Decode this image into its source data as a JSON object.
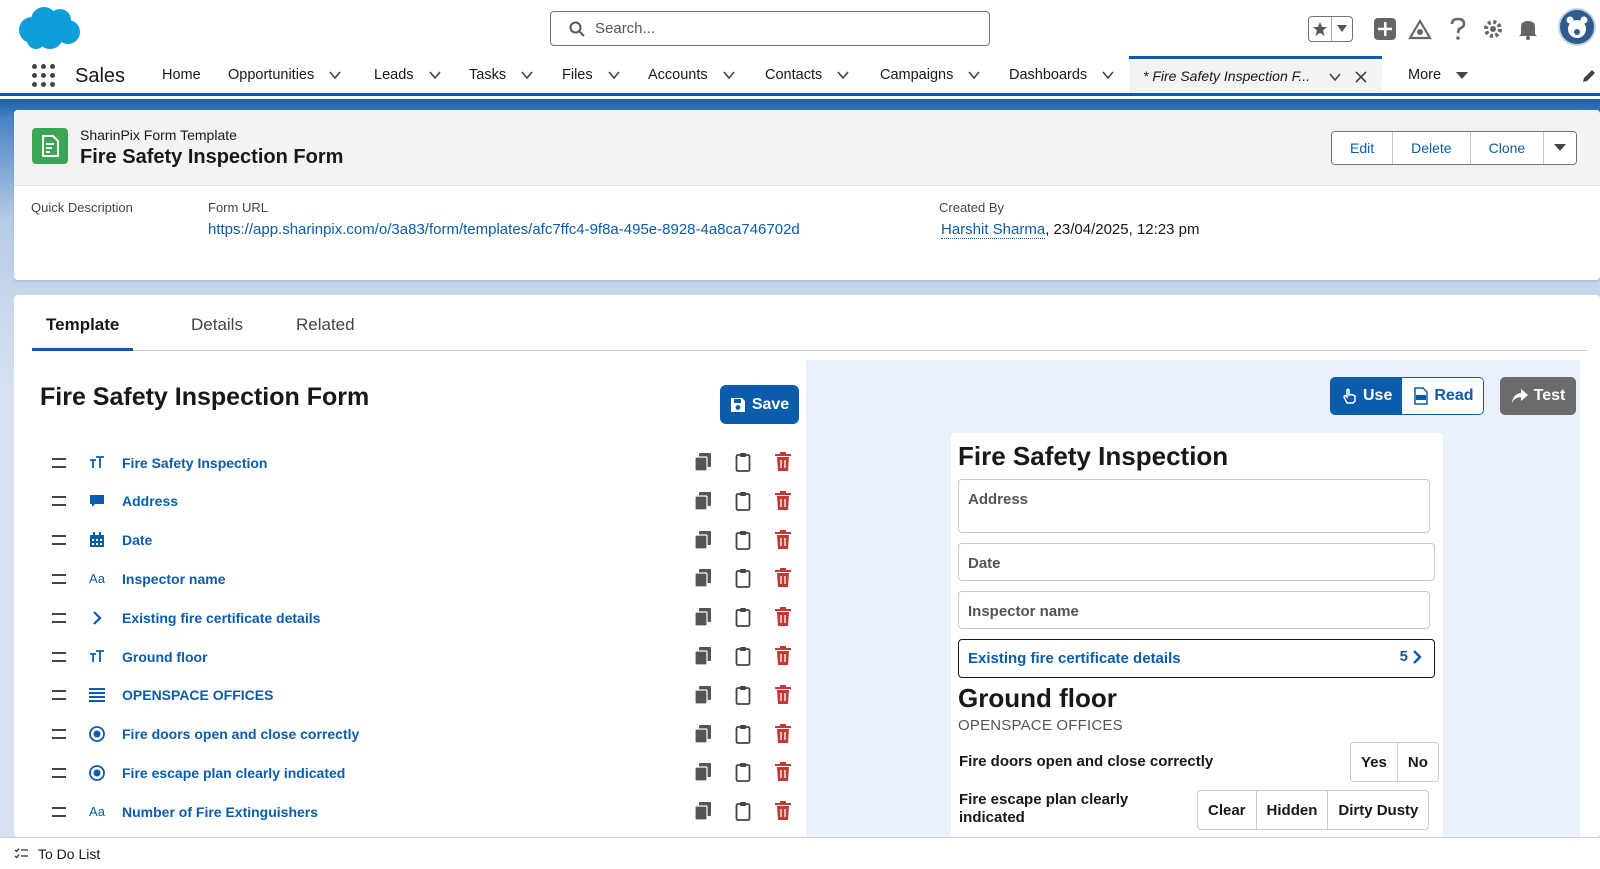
{
  "header": {
    "search_placeholder": "Search...",
    "icons": [
      "salesforce-cloud-logo",
      "favorites-star-icon",
      "add-icon",
      "trailhead-icon",
      "help-icon",
      "setup-gear-icon",
      "notifications-bell-icon",
      "user-avatar"
    ]
  },
  "nav": {
    "app_name": "Sales",
    "items": [
      {
        "label": "Home",
        "has_menu": false
      },
      {
        "label": "Opportunities",
        "has_menu": true
      },
      {
        "label": "Leads",
        "has_menu": true
      },
      {
        "label": "Tasks",
        "has_menu": true
      },
      {
        "label": "Files",
        "has_menu": true
      },
      {
        "label": "Accounts",
        "has_menu": true
      },
      {
        "label": "Contacts",
        "has_menu": true
      },
      {
        "label": "Campaigns",
        "has_menu": true
      },
      {
        "label": "Dashboards",
        "has_menu": true
      }
    ],
    "active_tab": "* Fire Safety Inspection F...",
    "more": "More"
  },
  "record": {
    "object_type": "SharinPix Form Template",
    "name": "Fire Safety Inspection Form",
    "actions": [
      "Edit",
      "Delete",
      "Clone"
    ],
    "fields": {
      "quick_description_label": "Quick Description",
      "form_url_label": "Form URL",
      "form_url": "https://app.sharinpix.com/o/3a83/form/templates/afc7ffc4-9f8a-495e-8928-4a8ca746702d",
      "created_by_label": "Created By",
      "created_by_user": "Harshit Sharma",
      "created_by_date": ", 23/04/2025, 12:23 pm"
    }
  },
  "tabs": [
    "Template",
    "Details",
    "Related"
  ],
  "editor": {
    "title": "Fire Safety Inspection Form",
    "save_label": "Save",
    "rows": [
      {
        "icon": "heading-icon",
        "label": "Fire Safety Inspection"
      },
      {
        "icon": "text-area-icon",
        "label": "Address"
      },
      {
        "icon": "calendar-icon",
        "label": "Date"
      },
      {
        "icon": "text-input-icon",
        "label": "Inspector name"
      },
      {
        "icon": "chevron-right-icon",
        "label": "Existing fire certificate details"
      },
      {
        "icon": "heading-icon",
        "label": "Ground floor"
      },
      {
        "icon": "paragraph-icon",
        "label": "OPENSPACE OFFICES"
      },
      {
        "icon": "radio-icon",
        "label": "Fire doors open and close correctly"
      },
      {
        "icon": "radio-icon",
        "label": "Fire escape plan clearly indicated"
      },
      {
        "icon": "text-input-icon",
        "label": "Number of Fire Extinguishers"
      }
    ]
  },
  "preview": {
    "modes": {
      "use": "Use",
      "read": "Read",
      "active": "Use"
    },
    "test_label": "Test",
    "title": "Fire Safety Inspection",
    "fields": {
      "address": "Address",
      "date": "Date",
      "inspector": "Inspector name"
    },
    "nav_item": {
      "label": "Existing fire certificate details",
      "count": "5"
    },
    "section_title": "Ground floor",
    "section_sub": "OPENSPACE OFFICES",
    "questions": [
      {
        "label": "Fire doors open and close correctly",
        "options": [
          "Yes",
          "No"
        ]
      },
      {
        "label": "Fire escape plan clearly indicated",
        "options": [
          "Clear",
          "Hidden",
          "Dirty Dusty"
        ]
      }
    ]
  },
  "footer": {
    "label": "To Do List"
  },
  "colors": {
    "brand_blue": "#0b5cab",
    "delete_red": "#c23934",
    "object_green": "#3ba755"
  }
}
